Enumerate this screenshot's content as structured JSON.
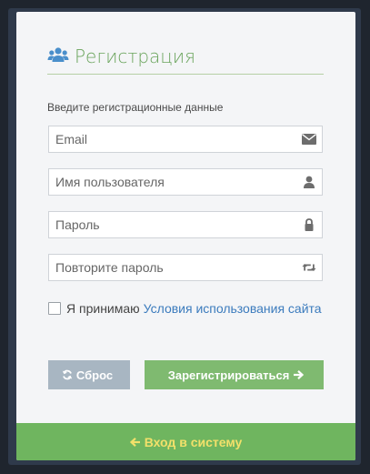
{
  "header": {
    "title": "Регистрация",
    "icon": "users-icon"
  },
  "form": {
    "subtitle": "Введите регистрационные данные",
    "fields": [
      {
        "placeholder": "Email",
        "value": "",
        "icon": "envelope-icon"
      },
      {
        "placeholder": "Имя пользователя",
        "value": "",
        "icon": "user-icon"
      },
      {
        "placeholder": "Пароль",
        "value": "",
        "icon": "lock-icon"
      },
      {
        "placeholder": "Повторите пароль",
        "value": "",
        "icon": "retweet-icon"
      }
    ],
    "terms": {
      "checked": false,
      "text": "Я принимаю",
      "link": "Условия использования сайта"
    },
    "reset_label": "Сброс",
    "register_label": "Зарегистрироваться"
  },
  "footer": {
    "login_label": "Вход в систему"
  },
  "colors": {
    "accent_green": "#6aa45c",
    "register_button": "#7fba70",
    "reset_button": "#a8b6c2",
    "footer_bg": "#6fb55f",
    "footer_text": "#f2e06a",
    "link": "#3b7bbd"
  }
}
